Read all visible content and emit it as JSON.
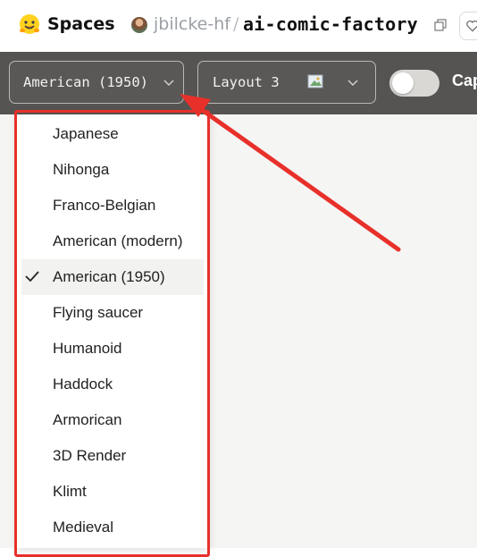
{
  "header": {
    "section": "Spaces",
    "owner": "jbilcke-hf",
    "separator": "/",
    "repo": "ai-comic-factory"
  },
  "toolbar": {
    "style_value": "American (1950)",
    "layout_value": "Layout 3",
    "caption_label": "Cap",
    "caption_toggle_on": false
  },
  "dropdown": {
    "selected": "American (1950)",
    "options": [
      "Japanese",
      "Nihonga",
      "Franco-Belgian",
      "American (modern)",
      "American (1950)",
      "Flying saucer",
      "Humanoid",
      "Haddock",
      "Armorican",
      "3D Render",
      "Klimt",
      "Medieval"
    ]
  },
  "icons": {
    "logo": "hugging-face-logo-icon",
    "copy": "copy-icon",
    "chevron": "chevron-down-icon",
    "broken_image": "broken-image-icon",
    "check": "check-icon"
  },
  "colors": {
    "toolbar_bg": "#555452",
    "annotation": "#e8302a"
  }
}
